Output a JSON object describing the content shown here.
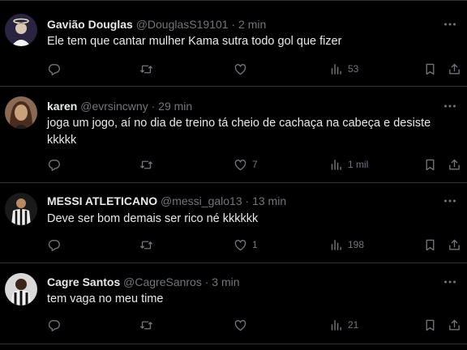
{
  "tweets": [
    {
      "name": "Gavião Douglas",
      "handle": "@DouglasS19101",
      "dot": "·",
      "time": "2 min",
      "lines": [
        "Ele tem que cantar mulher Kama sutra todo gol que fizer"
      ],
      "replies": "",
      "retweets": "",
      "likes": "",
      "views": "53",
      "avatar_colors": [
        "#d9c7b8",
        "#3a2a22"
      ]
    },
    {
      "name": "karen",
      "handle": "@evrsincwny",
      "dot": "·",
      "time": "29 min",
      "lines": [
        "joga um jogo, aí no dia de treino tá cheio de cachaça na cabeça e desiste",
        "kkkkk"
      ],
      "replies": "",
      "retweets": "",
      "likes": "7",
      "views": "1 mil",
      "avatar_colors": [
        "#c9a27c",
        "#4a2c1e"
      ]
    },
    {
      "name": "MESSI ATLETICANO",
      "handle": "@messi_galo13",
      "dot": "·",
      "time": "13 min",
      "lines": [
        "Deve ser bom demais ser rico né kkkkkk"
      ],
      "replies": "",
      "retweets": "",
      "likes": "1",
      "views": "198",
      "avatar_colors": [
        "#111111",
        "#eeeeee"
      ]
    },
    {
      "name": "Cagre Santos",
      "handle": "@CagreSanros",
      "dot": "·",
      "time": "3 min",
      "lines": [
        "tem vaga no meu time"
      ],
      "replies": "",
      "retweets": "",
      "likes": "",
      "views": "21",
      "avatar_colors": [
        "#111111",
        "#f2f2f2"
      ]
    }
  ],
  "colors": {
    "background": "#000000",
    "text": "#e7e9ea",
    "muted": "#71767b",
    "divider": "#2f3336"
  },
  "icons": [
    "more-icon",
    "reply-icon",
    "retweet-icon",
    "like-icon",
    "views-icon",
    "bookmark-icon",
    "share-icon"
  ]
}
